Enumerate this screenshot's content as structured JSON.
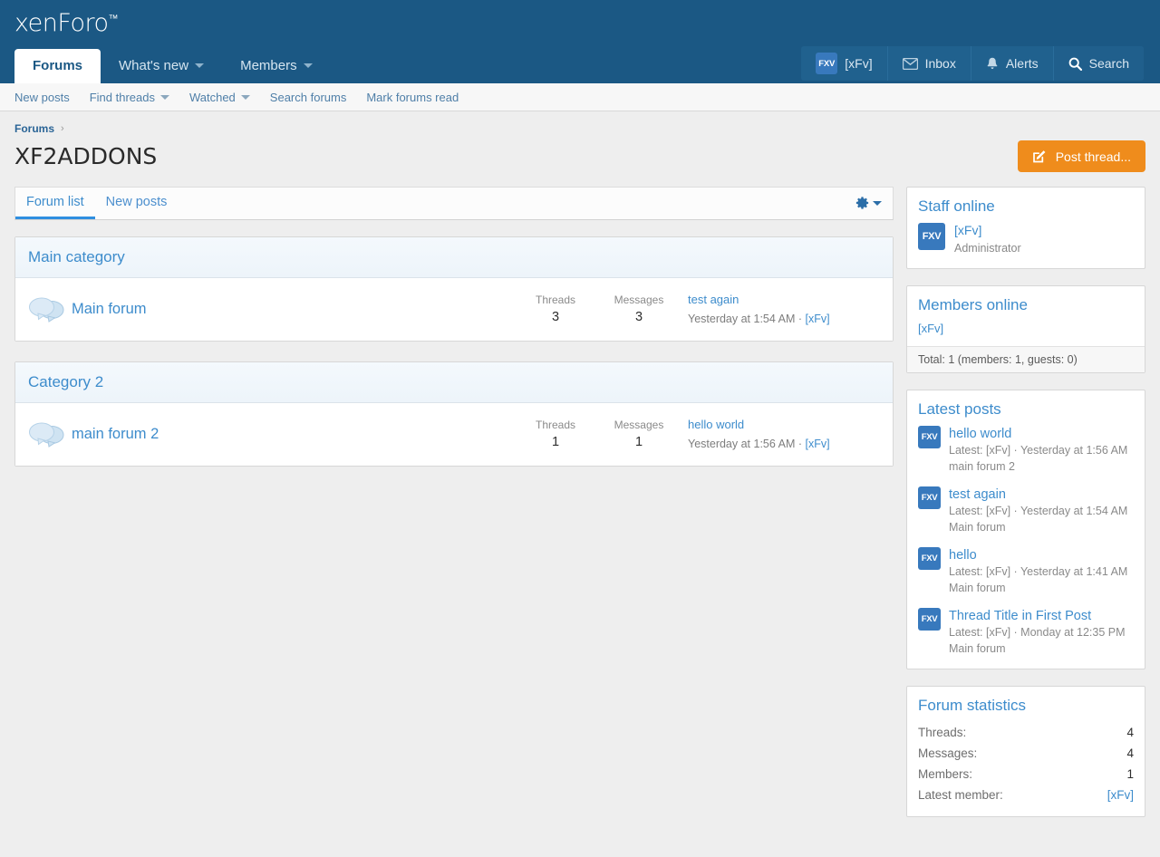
{
  "site": {
    "logo": "xenForo",
    "logo_tm": "™"
  },
  "header": {
    "nav": [
      {
        "label": "Forums",
        "selected": true,
        "has_caret": false
      },
      {
        "label": "What's new",
        "selected": false,
        "has_caret": true
      },
      {
        "label": "Members",
        "selected": false,
        "has_caret": true
      }
    ],
    "user": {
      "avatar_initials": "FXV",
      "username": "[xFv]",
      "inbox_label": "Inbox",
      "alerts_label": "Alerts",
      "search_label": "Search"
    }
  },
  "subnav": [
    {
      "label": "New posts",
      "has_caret": false
    },
    {
      "label": "Find threads",
      "has_caret": true
    },
    {
      "label": "Watched",
      "has_caret": true
    },
    {
      "label": "Search forums",
      "has_caret": false
    },
    {
      "label": "Mark forums read",
      "has_caret": false
    }
  ],
  "breadcrumb": {
    "root": "Forums",
    "separator": "›"
  },
  "page": {
    "title": "XF2ADDONS",
    "post_thread_label": "Post thread..."
  },
  "tabs": [
    {
      "label": "Forum list",
      "active": true
    },
    {
      "label": "New posts",
      "active": false
    }
  ],
  "categories": [
    {
      "title": "Main category",
      "forums": [
        {
          "title": "Main forum",
          "threads_label": "Threads",
          "threads_value": "3",
          "messages_label": "Messages",
          "messages_value": "3",
          "last_thread": "test again",
          "last_meta_time": "Yesterday at 1:54 AM",
          "last_meta_sep": " · ",
          "last_meta_user": "[xFv]"
        }
      ]
    },
    {
      "title": "Category 2",
      "forums": [
        {
          "title": "main forum 2",
          "threads_label": "Threads",
          "threads_value": "1",
          "messages_label": "Messages",
          "messages_value": "1",
          "last_thread": "hello world",
          "last_meta_time": "Yesterday at 1:56 AM",
          "last_meta_sep": " · ",
          "last_meta_user": "[xFv]"
        }
      ]
    }
  ],
  "sidebar": {
    "staff_online": {
      "title": "Staff online",
      "members": [
        {
          "avatar_initials": "FXV",
          "name": "[xFv]",
          "role": "Administrator"
        }
      ]
    },
    "members_online": {
      "title": "Members online",
      "members": [
        "[xFv]"
      ],
      "total": "Total: 1 (members: 1, guests: 0)"
    },
    "latest_posts": {
      "title": "Latest posts",
      "posts": [
        {
          "avatar_initials": "FXV",
          "title": "hello world",
          "meta": "Latest: [xFv] · Yesterday at 1:56 AM",
          "forum": "main forum 2"
        },
        {
          "avatar_initials": "FXV",
          "title": "test again",
          "meta": "Latest: [xFv] · Yesterday at 1:54 AM",
          "forum": "Main forum"
        },
        {
          "avatar_initials": "FXV",
          "title": "hello",
          "meta": "Latest: [xFv] · Yesterday at 1:41 AM",
          "forum": "Main forum"
        },
        {
          "avatar_initials": "FXV",
          "title": "Thread Title in First Post",
          "meta": "Latest: [xFv] · Monday at 12:35 PM",
          "forum": "Main forum"
        }
      ]
    },
    "forum_statistics": {
      "title": "Forum statistics",
      "rows": [
        {
          "key": "Threads:",
          "value": "4",
          "is_link": false
        },
        {
          "key": "Messages:",
          "value": "4",
          "is_link": false
        },
        {
          "key": "Members:",
          "value": "1",
          "is_link": false
        },
        {
          "key": "Latest member:",
          "value": "[xFv]",
          "is_link": true
        }
      ]
    }
  },
  "colors": {
    "header_blue": "#1b5884",
    "link_blue": "#3d8ccc",
    "accent_orange": "#ef8c1c",
    "avatar_blue": "#3879bd",
    "page_bg": "#eeeeee"
  }
}
